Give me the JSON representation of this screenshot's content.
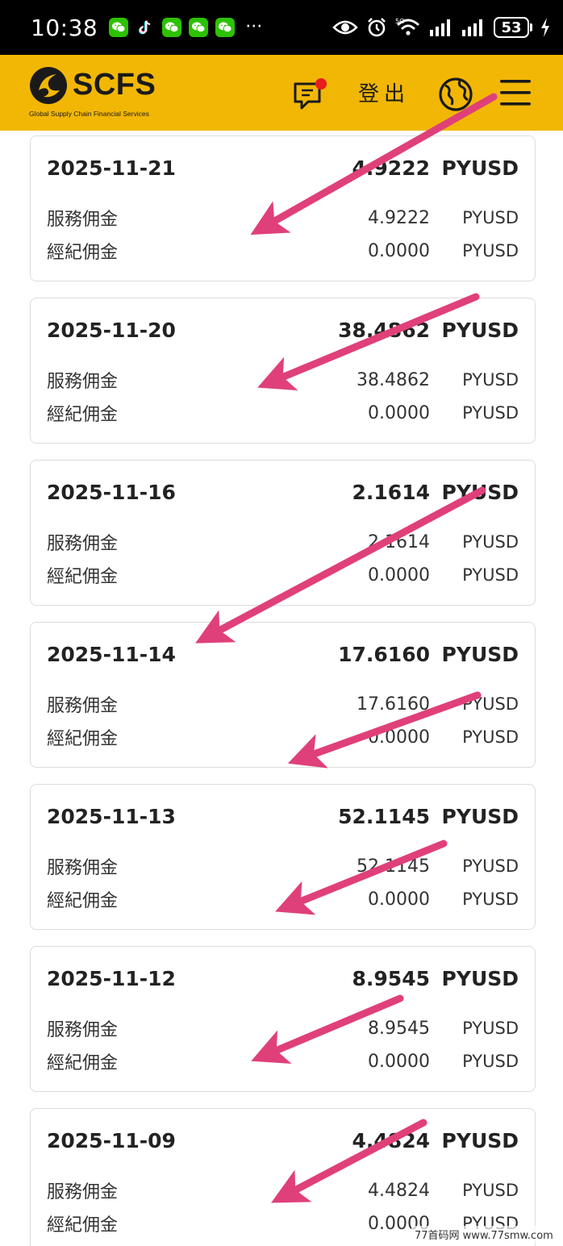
{
  "status_bar": {
    "time": "10:38",
    "battery": "53",
    "network": "5G",
    "icons": [
      "wechat-icon",
      "tiktok-icon",
      "wechat-icon",
      "wechat-icon",
      "wechat-icon",
      "eye-icon",
      "alarm-icon",
      "wifi-icon",
      "signal-icon",
      "signal-icon",
      "battery-icon",
      "charging-icon"
    ]
  },
  "header": {
    "logo_text": "SCFS",
    "logo_subtitle": "Global Supply Chain Financial Services",
    "logout_label": "登出",
    "has_notification": true,
    "icons": [
      "message-icon",
      "globe-icon",
      "menu-icon"
    ]
  },
  "records": [
    {
      "date": "2025-11-21",
      "total": "4.9222",
      "currency": "PYUSD",
      "items": [
        {
          "label": "服務佣金",
          "value": "4.9222",
          "currency": "PYUSD"
        },
        {
          "label": "經紀佣金",
          "value": "0.0000",
          "currency": "PYUSD"
        }
      ]
    },
    {
      "date": "2025-11-20",
      "total": "38.4862",
      "currency": "PYUSD",
      "items": [
        {
          "label": "服務佣金",
          "value": "38.4862",
          "currency": "PYUSD"
        },
        {
          "label": "經紀佣金",
          "value": "0.0000",
          "currency": "PYUSD"
        }
      ]
    },
    {
      "date": "2025-11-16",
      "total": "2.1614",
      "currency": "PYUSD",
      "items": [
        {
          "label": "服務佣金",
          "value": "2.1614",
          "currency": "PYUSD"
        },
        {
          "label": "經紀佣金",
          "value": "0.0000",
          "currency": "PYUSD"
        }
      ]
    },
    {
      "date": "2025-11-14",
      "total": "17.6160",
      "currency": "PYUSD",
      "items": [
        {
          "label": "服務佣金",
          "value": "17.6160",
          "currency": "PYUSD"
        },
        {
          "label": "經紀佣金",
          "value": "0.0000",
          "currency": "PYUSD"
        }
      ]
    },
    {
      "date": "2025-11-13",
      "total": "52.1145",
      "currency": "PYUSD",
      "items": [
        {
          "label": "服務佣金",
          "value": "52.1145",
          "currency": "PYUSD"
        },
        {
          "label": "經紀佣金",
          "value": "0.0000",
          "currency": "PYUSD"
        }
      ]
    },
    {
      "date": "2025-11-12",
      "total": "8.9545",
      "currency": "PYUSD",
      "items": [
        {
          "label": "服務佣金",
          "value": "8.9545",
          "currency": "PYUSD"
        },
        {
          "label": "經紀佣金",
          "value": "0.0000",
          "currency": "PYUSD"
        }
      ]
    },
    {
      "date": "2025-11-09",
      "total": "4.4824",
      "currency": "PYUSD",
      "items": [
        {
          "label": "服務佣金",
          "value": "4.4824",
          "currency": "PYUSD"
        },
        {
          "label": "經紀佣金",
          "value": "0.0000",
          "currency": "PYUSD"
        }
      ]
    }
  ],
  "colors": {
    "header_bg": "#f2b705",
    "arrow": "#e0407a",
    "notification_dot": "#e81d1d"
  },
  "watermark": "77首码网 www.77smw.com"
}
